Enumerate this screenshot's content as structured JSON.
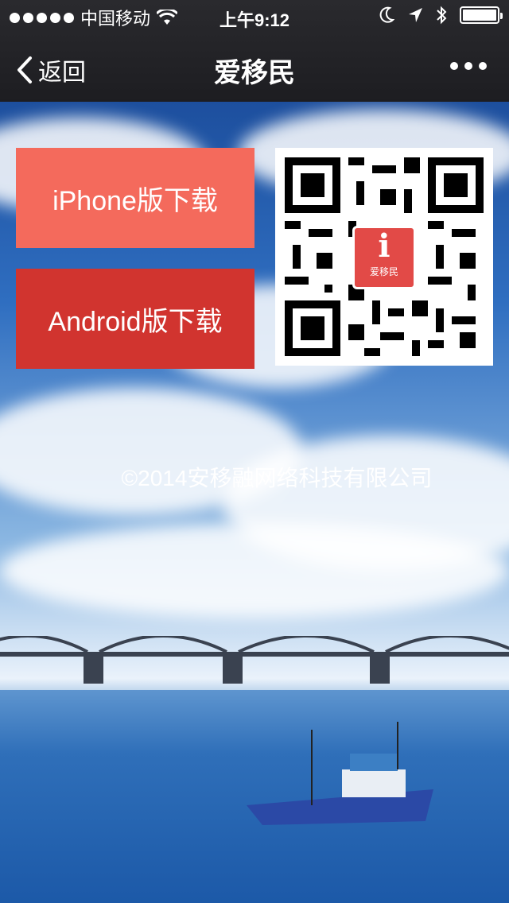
{
  "status_bar": {
    "carrier": "中国移动",
    "time": "上午9:12"
  },
  "nav": {
    "back_label": "返回",
    "title": "爱移民"
  },
  "buttons": {
    "iphone": "iPhone版下载",
    "android": "Android版下载"
  },
  "qr": {
    "logo_letter": "i",
    "logo_text": "爱移民"
  },
  "footer": {
    "copyright": "©2014安移融网络科技有限公司"
  },
  "colors": {
    "iphone_button": "#f46a5c",
    "android_button": "#d1342f",
    "nav_bar": "#1d1d21"
  }
}
